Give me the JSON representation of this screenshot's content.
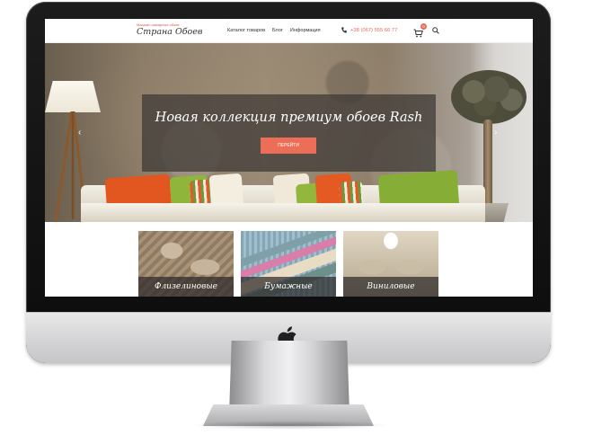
{
  "site": {
    "tagline": "Магазин шикарных обоев",
    "brand": "Страна Обоев"
  },
  "nav": {
    "items": [
      "Каталог товаров",
      "Блог",
      "Информация"
    ]
  },
  "contact": {
    "phone": "+38 (067) 555 66 77"
  },
  "cart": {
    "count": "0"
  },
  "hero": {
    "title": "Новая коллекция премиум обоев Rash",
    "button_label": "ПЕРЕЙТИ",
    "prev_arrow": "‹",
    "next_arrow": "›"
  },
  "categories": [
    {
      "label": "Флизелиновые"
    },
    {
      "label": "Бумажные"
    },
    {
      "label": "Виниловые"
    }
  ],
  "colors": {
    "accent": "#ec6e57",
    "overlay": "#3c3834"
  },
  "icons": [
    "phone-icon",
    "cart-icon",
    "search-icon",
    "apple-logo-icon"
  ]
}
